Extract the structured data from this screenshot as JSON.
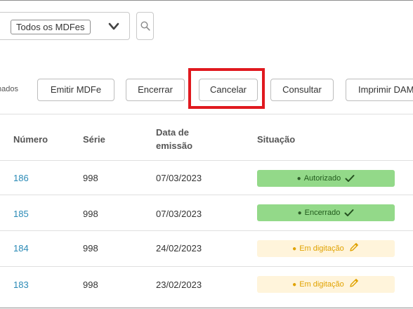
{
  "filter": {
    "selected": "Todos os MDFes"
  },
  "toolbar": {
    "selected_label": "nados",
    "emitir": "Emitir MDFe",
    "encerrar": "Encerrar",
    "cancelar": "Cancelar",
    "consultar": "Consultar",
    "imprimir": "Imprimir DAMDFe"
  },
  "table": {
    "headers": {
      "numero": "Número",
      "serie": "Série",
      "data_l1": "Data de",
      "data_l2": "emissão",
      "situacao": "Situação"
    },
    "rows": [
      {
        "numero": "186",
        "serie": "998",
        "data": "07/03/2023",
        "situacao": "Autorizado",
        "status_type": "ok",
        "status_icon": "check-icon"
      },
      {
        "numero": "185",
        "serie": "998",
        "data": "07/03/2023",
        "situacao": "Encerrado",
        "status_type": "ok",
        "status_icon": "check-icon"
      },
      {
        "numero": "184",
        "serie": "998",
        "data": "24/02/2023",
        "situacao": "Em digitação",
        "status_type": "edit",
        "status_icon": "pencil-icon"
      },
      {
        "numero": "183",
        "serie": "998",
        "data": "23/02/2023",
        "situacao": "Em digitação",
        "status_type": "edit",
        "status_icon": "pencil-icon"
      }
    ]
  },
  "colors": {
    "highlight": "#e0191f",
    "link": "#2a8ab6",
    "status_ok_bg": "#93d989",
    "status_edit_bg": "#fff4db",
    "status_edit_fg": "#e0a200"
  }
}
